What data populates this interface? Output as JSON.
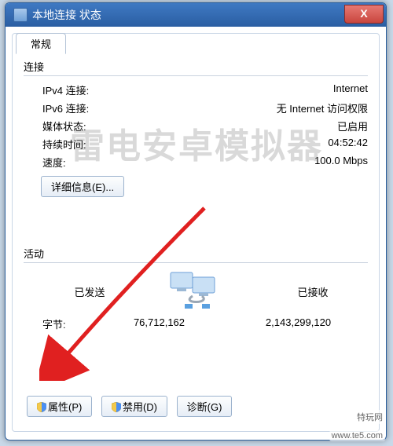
{
  "window": {
    "title": "本地连接 状态",
    "close_glyph": "X"
  },
  "tabs": {
    "general": "常规"
  },
  "connection": {
    "group_title": "连接",
    "ipv4_label": "IPv4 连接:",
    "ipv4_value": "Internet",
    "ipv6_label": "IPv6 连接:",
    "ipv6_value": "无 Internet 访问权限",
    "media_label": "媒体状态:",
    "media_value": "已启用",
    "duration_label": "持续时间:",
    "duration_value": "04:52:42",
    "speed_label": "速度:",
    "speed_value": "100.0 Mbps",
    "details_btn": "详细信息(E)..."
  },
  "activity": {
    "group_title": "活动",
    "sent_label": "已发送",
    "recv_label": "已接收",
    "bytes_label": "字节:",
    "sent_bytes": "76,712,162",
    "recv_bytes": "2,143,299,120"
  },
  "buttons": {
    "properties": "属性(P)",
    "disable": "禁用(D)",
    "diagnose": "诊断(G)"
  },
  "watermark": {
    "main": "雷电安卓模拟器",
    "corner1": "特玩网",
    "corner2": "www.te5.com"
  }
}
